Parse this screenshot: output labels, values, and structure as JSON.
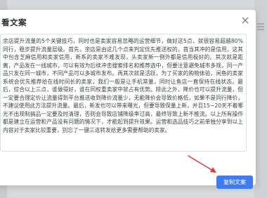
{
  "dialog": {
    "title": "看文案",
    "close_icon": "close-icon",
    "content": "余店提升流量的5个关键技巧，同时也是卖家容易忽略的运营细节，做好这5点，就很容易超越80%同行，稳步提升流量层级。首先，余店是由这几个点来判定优先推送权的，首当其冲的是信用，这其中包含芝麻信用和卖家信用，新系的卖家不难发现，头卖家新一例外都是信用极好的。其次就是距离，产品发在一线城市，可以有效为后续冲击搜索排名和推荐选中，但要注意避免城市多规，同一产品只发在同一城市，不同产品可以多城市发布。再其次就是活跃，为了买家的购物体验，闲鱼的卖家系统会优先推荐给在线时间长的卖家，我们一般是让手机常量，同时让鱼店一直保持在线状态。最后，综合以上三点，谁做得好，谁在同权重卖家中就占有优势。除此之外，降价也可以提升流量，但一定要合理定价让流量得到平台推送收到降价流量少，无能降价会导致价格低，如果不是同行降价，不建议使用此方法提升流量。最后，新发也可以带来曝光，但要导致保量上新，并且15~20天不着哪光不出规制搞品一定要及时清理，否则会导致店铺降级率过高，最终导致上新不推流。以上所有操作都是建立在运营和产品没有问题的情况下，才能起到提升效果。运营和选品技巧之前单独分享到以上内容对于卖家比较重要，别忘了一键三连转发给更多需要帮助的卖家。",
    "copy_button_label": "复制文案"
  },
  "colors": {
    "accent": "#3f7cf0",
    "annotation_arrow": "#e03a3a"
  }
}
